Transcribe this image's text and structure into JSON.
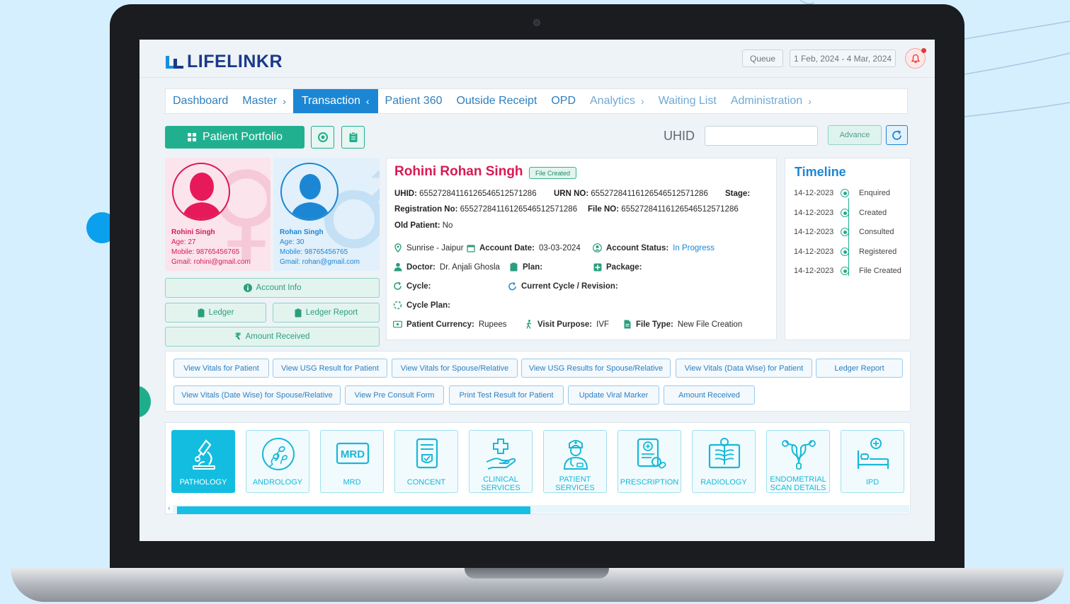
{
  "brand": {
    "name": "LIFELINKR"
  },
  "header": {
    "queue_label": "Queue",
    "date_range": "1 Feb, 2024 - 4 Mar, 2024"
  },
  "nav": {
    "items": [
      {
        "label": "Dashboard",
        "chevron": ""
      },
      {
        "label": "Master",
        "chevron": "›"
      },
      {
        "label": "Transaction",
        "chevron": "‹",
        "active": true
      },
      {
        "label": "Patient 360",
        "chevron": ""
      },
      {
        "label": "Outside Receipt",
        "chevron": ""
      },
      {
        "label": "OPD",
        "chevron": ""
      },
      {
        "label": "Analytics",
        "chevron": "›"
      },
      {
        "label": "Waiting List",
        "chevron": ""
      },
      {
        "label": "Administration",
        "chevron": "›"
      }
    ]
  },
  "toolbar": {
    "portfolio_label": "Patient Portfolio",
    "uhid_label": "UHID",
    "uhid_value": "",
    "advance_label": "Advance"
  },
  "couple": {
    "wife": {
      "name": "Rohini Singh",
      "age": "Age: 27",
      "mobile": "Mobile: 98765456765",
      "gmail": "Gmail: rohini@gmail.com"
    },
    "husband": {
      "name": "Rohan Singh",
      "age": "Age: 30",
      "mobile": "Mobile: 98765456765",
      "gmail": "Gmail: rohan@gmail.com"
    }
  },
  "actions": {
    "account_info": "Account Info",
    "ledger": "Ledger",
    "ledger_report": "Ledger Report",
    "amount_received": "Amount Received"
  },
  "patient": {
    "name": "Rohini Rohan Singh",
    "badge": "File Created",
    "uhid_label": "UHID:",
    "uhid": "65527284116126546512571286",
    "urn_label": "URN NO:",
    "urn": "65527284116126546512571286",
    "stage_label": "Stage:",
    "reg_label": "Registration No:",
    "reg": "65527284116126546512571286",
    "file_label": "File NO:",
    "file": "65527284116126546512571286",
    "old_label": "Old Patient:",
    "old": "No",
    "location": "Sunrise - Jaipur",
    "account_date_label": "Account Date:",
    "account_date": "03-03-2024",
    "account_status_label": "Account Status:",
    "account_status": "In Progress",
    "doctor_label": "Doctor:",
    "doctor": "Dr. Anjali Ghosla",
    "plan_label": "Plan:",
    "package_label": "Package:",
    "cycle_label": "Cycle:",
    "current_cycle_label": "Current Cycle / Revision:",
    "cycle_plan_label": "Cycle Plan:",
    "currency_label": "Patient Currency:",
    "currency": "Rupees",
    "visit_purpose_label": "Visit Purpose:",
    "visit_purpose": "IVF",
    "file_type_label": "File Type:",
    "file_type": "New File Creation"
  },
  "timeline": {
    "title": "Timeline",
    "entries": [
      {
        "date": "14-12-2023",
        "status": "Enquired"
      },
      {
        "date": "14-12-2023",
        "status": "Created"
      },
      {
        "date": "14-12-2023",
        "status": "Consulted"
      },
      {
        "date": "14-12-2023",
        "status": "Registered"
      },
      {
        "date": "14-12-2023",
        "status": "File Created"
      }
    ]
  },
  "quick_links": {
    "row1": [
      "View Vitals for Patient",
      "View USG Result for Patient",
      "View Vitals for Spouse/Relative",
      "View USG Results for Spouse/Relative",
      "View Vitals (Data Wise) for Patient",
      "Ledger Report"
    ],
    "row2": [
      "View Vitals (Date Wise) for Spouse/Relative",
      "View Pre Consult Form",
      "Print Test Result for Patient",
      "Update Viral Marker",
      "Amount Received"
    ]
  },
  "modules": [
    {
      "label": "PATHOLOGY",
      "icon": "microscope-icon"
    },
    {
      "label": "ANDROLOGY",
      "icon": "sperm-icon"
    },
    {
      "label": "MRD",
      "icon": "mrd-icon"
    },
    {
      "label": "CONCENT",
      "icon": "document-icon"
    },
    {
      "label": "CLINICAL SERVICES",
      "icon": "hand-medical-icon"
    },
    {
      "label": "PATIENT SERVICES",
      "icon": "nurse-icon"
    },
    {
      "label": "PRESCRIPTION",
      "icon": "prescription-icon"
    },
    {
      "label": "RADIOLOGY",
      "icon": "xray-icon"
    },
    {
      "label": "ENDOMETRIAL SCAN DETAILS",
      "icon": "uterus-icon"
    },
    {
      "label": "IPD",
      "icon": "hospital-bed-icon"
    }
  ],
  "colors": {
    "brand_blue": "#1a3a88",
    "nav_active": "#1b87d4",
    "accent_green": "#20b08f",
    "patient_name": "#d71a55",
    "tile_cyan": "#13bde0"
  }
}
